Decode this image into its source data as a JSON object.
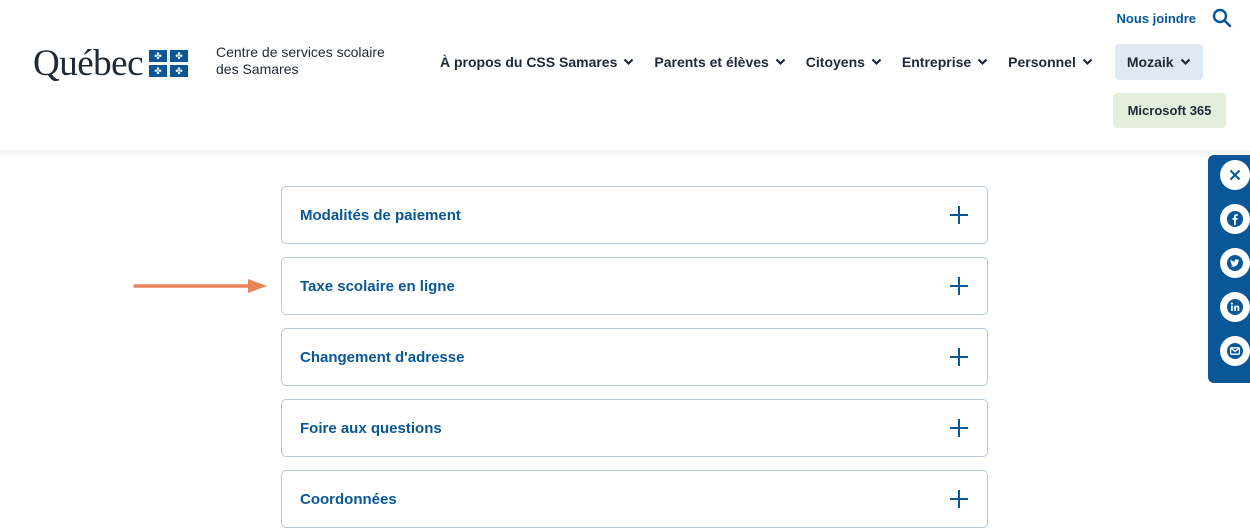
{
  "header": {
    "util_link": "Nous joindre",
    "logo_text": "Québec",
    "org_name_line1": "Centre de services scolaire",
    "org_name_line2": "des Samares"
  },
  "nav": {
    "items": [
      {
        "label": "À propos du CSS Samares"
      },
      {
        "label": "Parents et élèves"
      },
      {
        "label": "Citoyens"
      },
      {
        "label": "Entreprise"
      },
      {
        "label": "Personnel"
      },
      {
        "label": "Mozaik"
      }
    ],
    "ms365": "Microsoft 365"
  },
  "accordions": [
    {
      "title": "Modalités de paiement"
    },
    {
      "title": "Taxe scolaire en ligne"
    },
    {
      "title": "Changement d'adresse"
    },
    {
      "title": "Foire aux questions"
    },
    {
      "title": "Coordonnées"
    }
  ],
  "icons": {
    "search": "search-icon",
    "chevron": "chevron-down-icon",
    "plus": "plus-icon",
    "arrow": "arrow-right-icon",
    "close": "close-icon",
    "facebook": "facebook-icon",
    "twitter": "twitter-icon",
    "linkedin": "linkedin-icon",
    "email": "email-icon"
  },
  "colors": {
    "brand_blue": "#095797",
    "mozaik_bg": "#dfe8f4",
    "ms365_bg": "#e3eedb",
    "arrow": "#e8835a"
  }
}
